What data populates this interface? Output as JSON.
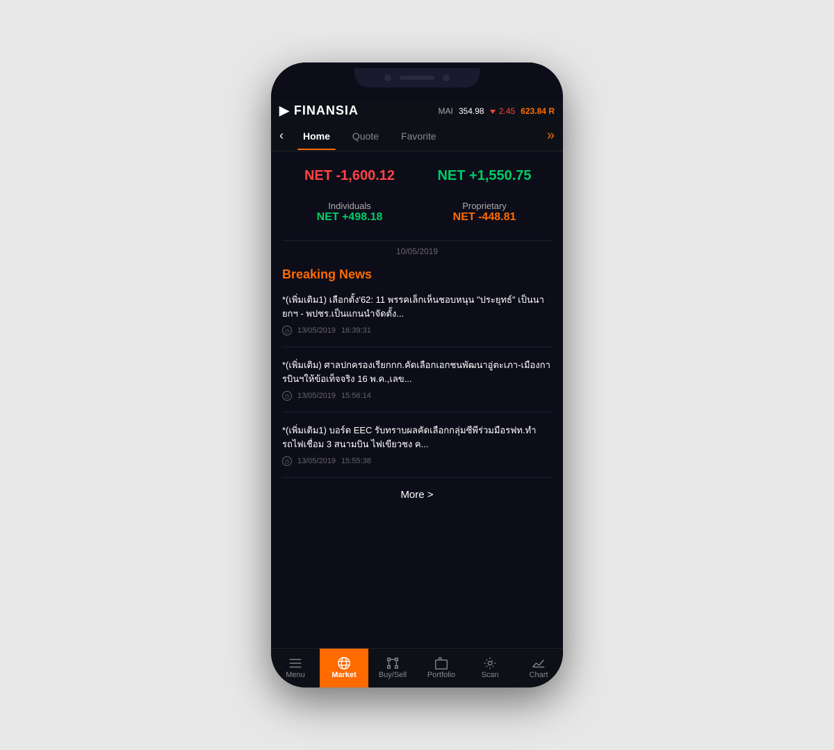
{
  "app": {
    "logo_prefix": "FINANSIA",
    "market": {
      "label": "MAI",
      "value": "354.98",
      "change": "2.45",
      "direction": "down"
    },
    "account_value": "623.84",
    "account_badge": "R"
  },
  "nav_tabs": {
    "back_icon": "‹",
    "tabs": [
      {
        "label": "Home",
        "active": true
      },
      {
        "label": "Quote",
        "active": false
      },
      {
        "label": "Favorite",
        "active": false
      }
    ],
    "more_icon": "»"
  },
  "net_values": {
    "foreign": {
      "label_prefix": "NET",
      "value": "-1,600.12",
      "color": "negative"
    },
    "proprietary_top": {
      "label_prefix": "NET",
      "value": "+1,550.75",
      "color": "positive"
    },
    "individuals": {
      "section_label": "Individuals",
      "value": "+498.18"
    },
    "proprietary": {
      "section_label": "Proprietary",
      "value": "-448.81"
    },
    "date": "10/05/2019"
  },
  "breaking_news": {
    "title": "Breaking News",
    "items": [
      {
        "text": "*(เพิ่มเติม1) เลือกตั้ง'62: 11 พรรคเล็กเห็นชอบหนุน \"ประยุทธ์\" เป็นนายกฯ - พปชร.เป็นแกนนำจัดตั้ง...",
        "date": "13/05/2019",
        "time": "16:39:31"
      },
      {
        "text": "*(เพิ่มเติม) ศาลปกครองเรียกกก.คัดเลือกเอกชนพัฒนาอู่ตะเภา-เมืองการบินฯให้ข้อเท็จจริง 16 พ.ค.,เลข...",
        "date": "13/05/2019",
        "time": "15:56:14"
      },
      {
        "text": "*(เพิ่มเติม1) บอร์ด EEC รับทราบผลคัดเลือกกลุ่มซีพีร่วมมือรฟท.ทำรถไฟเชื่อม 3 สนามบิน ไฟเขียวชง ค...",
        "date": "13/05/2019",
        "time": "15:55:38"
      }
    ],
    "more_label": "More >"
  },
  "bottom_nav": {
    "items": [
      {
        "label": "Menu",
        "icon": "menu",
        "active": false
      },
      {
        "label": "Market",
        "icon": "globe",
        "active": true
      },
      {
        "label": "Buy/Sell",
        "icon": "buysell",
        "active": false
      },
      {
        "label": "Portfolio",
        "icon": "portfolio",
        "active": false
      },
      {
        "label": "Scan",
        "icon": "scan",
        "active": false
      },
      {
        "label": "Chart",
        "icon": "chart",
        "active": false
      }
    ]
  }
}
